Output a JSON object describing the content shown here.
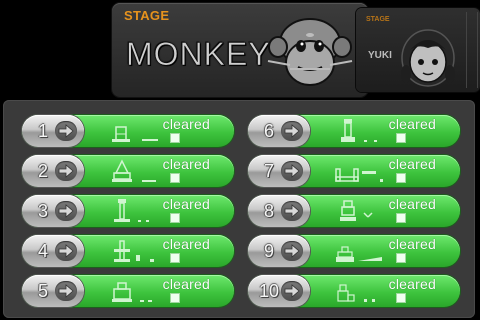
{
  "header": {
    "stage_label": "STAGE",
    "stage_name": "MONKEY",
    "next_tag": "STAGE",
    "next_name": "YUKI"
  },
  "icons": {
    "arrow": "right-arrow-icon",
    "monkey": "monkey-face-icon",
    "girl": "girl-face-icon"
  },
  "colors": {
    "accent": "#e7931d",
    "row_green": "#4cd24c",
    "panel": "#3a3a3a"
  },
  "stages": [
    {
      "number": "1",
      "status": "cleared"
    },
    {
      "number": "2",
      "status": "cleared"
    },
    {
      "number": "3",
      "status": "cleared"
    },
    {
      "number": "4",
      "status": "cleared"
    },
    {
      "number": "5",
      "status": "cleared"
    },
    {
      "number": "6",
      "status": "cleared"
    },
    {
      "number": "7",
      "status": "cleared"
    },
    {
      "number": "8",
      "status": "cleared"
    },
    {
      "number": "9",
      "status": "cleared"
    },
    {
      "number": "10",
      "status": "cleared"
    }
  ]
}
